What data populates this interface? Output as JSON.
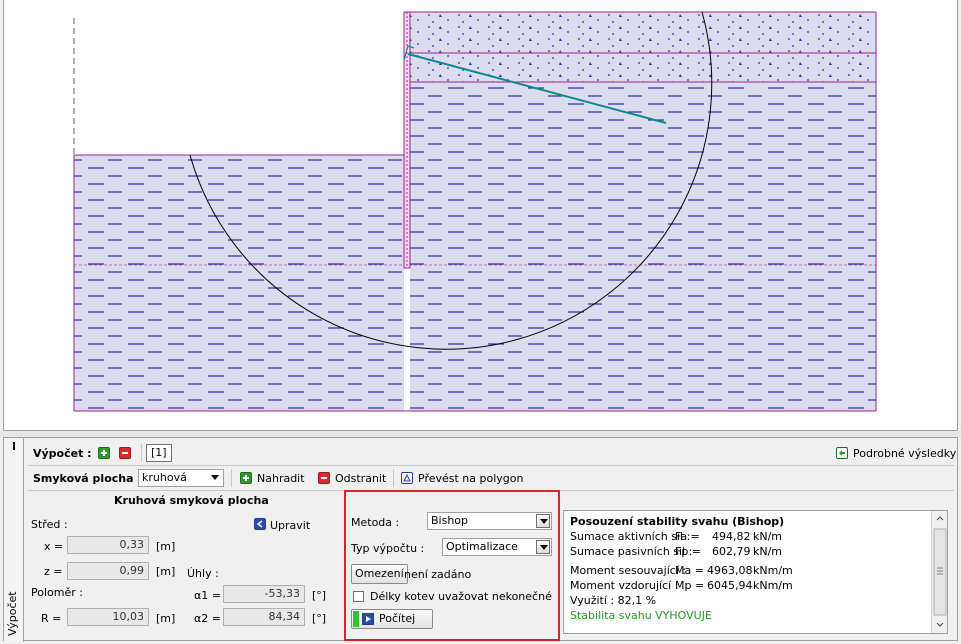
{
  "colors": {
    "soil_fill": "#dcdcf0",
    "soil_dash": "#2a2a9a",
    "boundary": "#a0208c",
    "anchor": "#0a8a8a",
    "highlight": "#d8232a",
    "ok_text": "#1f9a1f"
  },
  "toolbar": {
    "vypocet_label": "Výpočet :",
    "add_icon": "plus-icon",
    "remove_icon": "minus-icon",
    "stage_tab": "[1]",
    "detailed_results": "Podrobné výsledky"
  },
  "slip_row": {
    "label": "Smyková plocha :",
    "type_value": "kruhová",
    "replace_label": "Nahradit",
    "remove_label": "Odstranit",
    "convert_label": "Převést na polygon"
  },
  "circle_panel": {
    "title": "Kruhová smyková plocha",
    "center_label": "Střed :",
    "edit_label": "Upravit",
    "x_label": "x =",
    "x_value": "0,33",
    "x_unit": "[m]",
    "z_label": "z =",
    "z_value": "0,99",
    "z_unit": "[m]",
    "angles_label": "Úhly :",
    "radius_label": "Poloměr :",
    "r_label": "R =",
    "r_value": "10,03",
    "r_unit": "[m]",
    "alpha1_label": "α1 =",
    "alpha1_value": "-53,33",
    "alpha1_unit": "[°]",
    "alpha2_label": "α2 =",
    "alpha2_value": "84,34",
    "alpha2_unit": "[°]"
  },
  "method_panel": {
    "method_label": "Metoda :",
    "method_value": "Bishop",
    "calc_type_label": "Typ výpočtu :",
    "calc_type_value": "Optimalizace",
    "constraints_button": "Omezení",
    "constraints_status": "není zadáno",
    "anchor_checkbox_label": "Délky kotev uvažovat nekonečné",
    "anchor_checkbox_checked": false,
    "run_button": "Počítej"
  },
  "results": {
    "title": "Posouzení stability svahu (Bishop)",
    "line1_label": "Sumace aktivních sil :",
    "line1_sym": "Fa =",
    "line1_value": "494,82",
    "line1_unit": "kN/m",
    "line2_label": "Sumace pasivních sil :",
    "line2_sym": "Fp =",
    "line2_value": "602,79",
    "line2_unit": "kN/m",
    "line3_label": "Moment sesouvající :",
    "line3_sym": "Ma =",
    "line3_value": "4963,08",
    "line3_unit": "kNm/m",
    "line4_label": "Moment vzdorující :",
    "line4_sym": "Mp =",
    "line4_value": "6045,94",
    "line4_unit": "kNm/m",
    "utilization": "Využití : 82,1 %",
    "verdict": "Stabilita svahu VYHOVUJE"
  },
  "side_tab": "Výpočet"
}
